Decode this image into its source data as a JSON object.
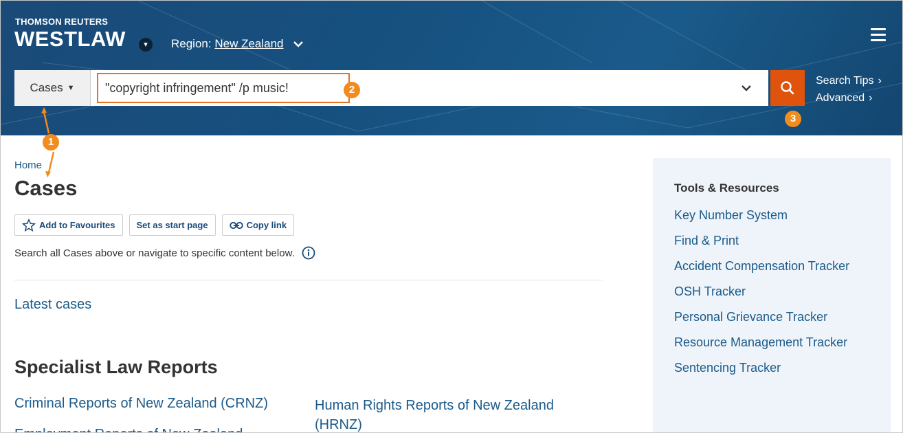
{
  "header": {
    "brand_top": "THOMSON REUTERS",
    "brand_main": "WESTLAW",
    "region_label": "Region:",
    "region_value": "New Zealand",
    "menu_icon": "hamburger-icon"
  },
  "search": {
    "category": "Cases",
    "query": "\"copyright infringement\" /p music!",
    "links": {
      "tips": "Search Tips",
      "advanced": "Advanced"
    },
    "search_icon": "search-icon"
  },
  "annotations": {
    "step1": "1",
    "step2": "2",
    "step3": "3"
  },
  "page": {
    "breadcrumb": "Home",
    "title": "Cases",
    "actions": {
      "favourites": "Add to Favourites",
      "start_page": "Set as start page",
      "copy_link": "Copy link"
    },
    "description": "Search all Cases above or navigate to specific content below.",
    "latest": "Latest cases",
    "specialist_title": "Specialist Law Reports",
    "reports": [
      "Criminal Reports of New Zealand (CRNZ)",
      "Human Rights Reports of New Zealand (HRNZ)",
      "Employment Reports of New Zealand"
    ]
  },
  "tools": {
    "title": "Tools & Resources",
    "items": [
      "Key Number System",
      "Find & Print",
      "Accident Compensation Tracker",
      "OSH Tracker",
      "Personal Grievance Tracker",
      "Resource Management Tracker",
      "Sentencing Tracker"
    ]
  },
  "colors": {
    "header_bg": "#16507f",
    "accent_orange": "#e0530c",
    "annotation_orange": "#f28c1e",
    "link_blue": "#1a5a8a",
    "sidebar_bg": "#eef4f9"
  }
}
